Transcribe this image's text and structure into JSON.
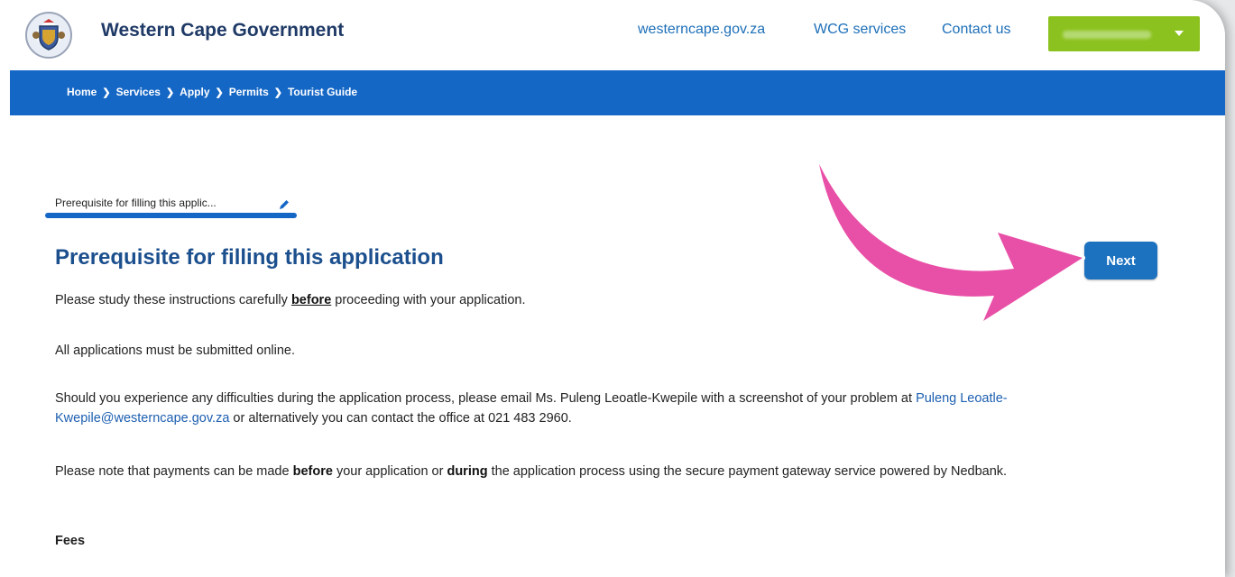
{
  "header": {
    "brand": "Western Cape Government",
    "links": [
      "westerncape.gov.za",
      "WCG services",
      "Contact us"
    ]
  },
  "breadcrumb": [
    "Home",
    "Services",
    "Apply",
    "Permits",
    "Tourist Guide"
  ],
  "section_tab": {
    "label": "Prerequisite for filling this applic..."
  },
  "page": {
    "title": "Prerequisite for filling this application",
    "next_label": "Next",
    "p1_pre": "Please study these instructions carefully ",
    "p1_strong": "before",
    "p1_post": " proceeding with your application.",
    "p2": "All applications must be submitted online.",
    "p3_pre": "Should you experience any difficulties during the application process, please email Ms. Puleng Leoatle-Kwepile with a screenshot of your problem at ",
    "p3_email": "Puleng Leoatle-Kwepile@westerncape.gov.za",
    "p3_post": " or alternatively you can contact the office at 021 483 2960.",
    "p4_a": "Please note that payments can be made ",
    "p4_b": "before",
    "p4_c": " your application or ",
    "p4_d": "during",
    "p4_e": " the application process using the secure payment gateway service powered by Nedbank.",
    "fees_heading": "Fees"
  },
  "colors": {
    "brand_blue": "#1567c6",
    "user_button": "#8cc21f",
    "annotation_arrow": "#e84fa7"
  },
  "icons": [
    "coat-of-arms-logo",
    "chevron-right-icon",
    "pencil-icon",
    "caret-down-icon"
  ]
}
